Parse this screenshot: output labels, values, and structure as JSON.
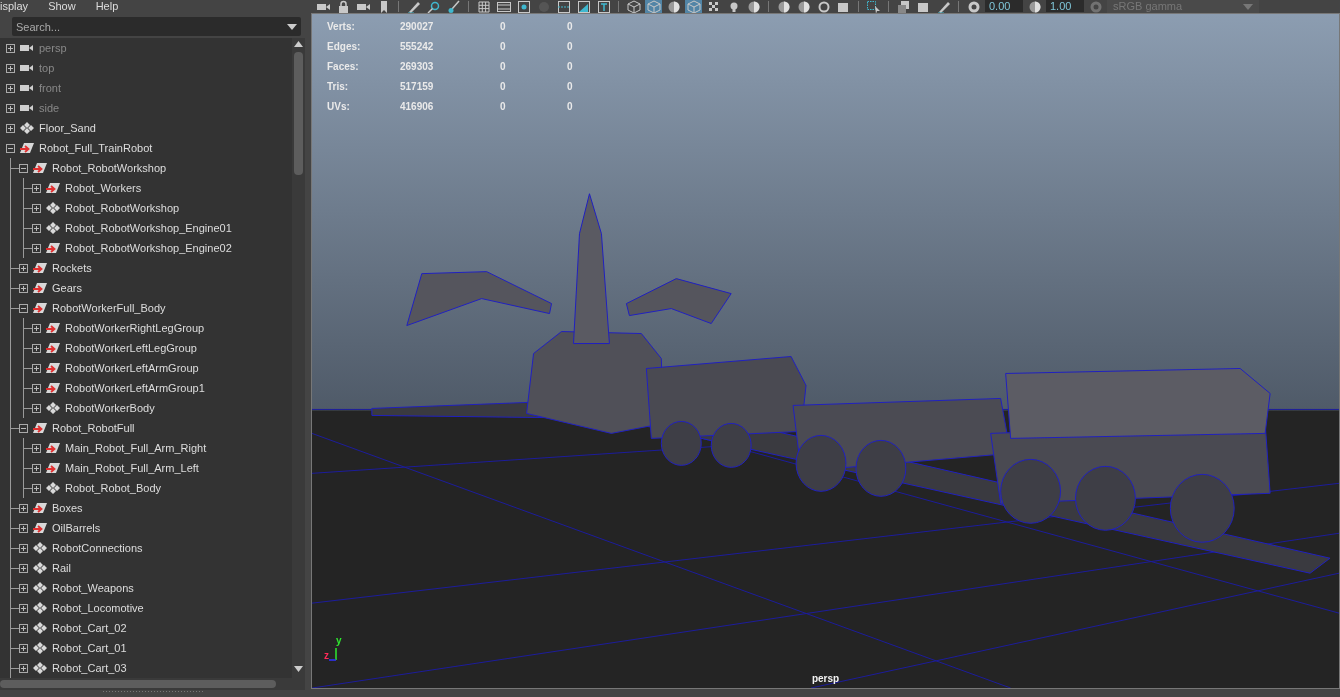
{
  "menu": [
    "isplay",
    "Show",
    "Help"
  ],
  "outliner": {
    "search": {
      "placeholder": "Search..."
    },
    "items": [
      {
        "label": "persp",
        "kind": "camera",
        "expanded": false
      },
      {
        "label": "top",
        "kind": "camera",
        "expanded": false
      },
      {
        "label": "front",
        "kind": "camera",
        "expanded": false
      },
      {
        "label": "side",
        "kind": "camera",
        "expanded": false
      },
      {
        "label": "Floor_Sand",
        "kind": "mesh",
        "expanded": false
      },
      {
        "label": "Robot_Full_TrainRobot",
        "kind": "group",
        "expanded": true,
        "children": [
          {
            "label": "Robot_RobotWorkshop",
            "kind": "group",
            "expanded": true,
            "children": [
              {
                "label": "Robot_Workers",
                "kind": "group",
                "expanded": false
              },
              {
                "label": "Robot_RobotWorkshop",
                "kind": "mesh",
                "expanded": false
              },
              {
                "label": "Robot_RobotWorkshop_Engine01",
                "kind": "mesh",
                "expanded": false
              },
              {
                "label": "Robot_RobotWorkshop_Engine02",
                "kind": "group",
                "expanded": false
              }
            ]
          },
          {
            "label": "Rockets",
            "kind": "group",
            "expanded": false
          },
          {
            "label": "Gears",
            "kind": "group",
            "expanded": false
          },
          {
            "label": "RobotWorkerFull_Body",
            "kind": "group",
            "expanded": true,
            "children": [
              {
                "label": "RobotWorkerRightLegGroup",
                "kind": "group",
                "expanded": false
              },
              {
                "label": "RobotWorkerLeftLegGroup",
                "kind": "group",
                "expanded": false
              },
              {
                "label": "RobotWorkerLeftArmGroup",
                "kind": "group",
                "expanded": false
              },
              {
                "label": "RobotWorkerLeftArmGroup1",
                "kind": "group",
                "expanded": false
              },
              {
                "label": "RobotWorkerBody",
                "kind": "mesh",
                "expanded": false
              }
            ]
          },
          {
            "label": "Robot_RobotFull",
            "kind": "group",
            "expanded": true,
            "children": [
              {
                "label": "Main_Robot_Full_Arm_Right",
                "kind": "group",
                "expanded": false
              },
              {
                "label": "Main_Robot_Full_Arm_Left",
                "kind": "group",
                "expanded": false
              },
              {
                "label": "Robot_Robot_Body",
                "kind": "mesh",
                "expanded": false
              }
            ]
          },
          {
            "label": "Boxes",
            "kind": "group",
            "expanded": false
          },
          {
            "label": "OilBarrels",
            "kind": "group",
            "expanded": false
          },
          {
            "label": "RobotConnections",
            "kind": "mesh",
            "expanded": false
          },
          {
            "label": "Rail",
            "kind": "mesh",
            "expanded": false
          },
          {
            "label": "Robot_Weapons",
            "kind": "mesh",
            "expanded": false
          },
          {
            "label": "Robot_Locomotive",
            "kind": "mesh",
            "expanded": false
          },
          {
            "label": "Robot_Cart_02",
            "kind": "mesh",
            "expanded": false
          },
          {
            "label": "Robot_Cart_01",
            "kind": "mesh",
            "expanded": false
          },
          {
            "label": "Robot_Cart_03",
            "kind": "mesh",
            "expanded": false
          }
        ]
      }
    ]
  },
  "viewport": {
    "toolbar": [
      {
        "kind": "camera",
        "selected": false
      },
      {
        "kind": "lock",
        "selected": false
      },
      {
        "kind": "camera",
        "selected": false
      },
      {
        "kind": "bookmark",
        "selected": false
      },
      {
        "kind": "separator"
      },
      {
        "kind": "pen",
        "selected": false
      },
      {
        "kind": "search",
        "selected": false
      },
      {
        "kind": "brush",
        "selected": false
      },
      {
        "kind": "separator"
      },
      {
        "kind": "grid",
        "selected": false
      },
      {
        "kind": "film",
        "selected": false
      },
      {
        "kind": "dot",
        "selected": false
      },
      {
        "kind": "circle",
        "selected": false
      },
      {
        "kind": "align",
        "selected": false
      },
      {
        "kind": "triangle",
        "selected": false
      },
      {
        "kind": "type",
        "selected": false
      },
      {
        "kind": "separator"
      },
      {
        "kind": "cube",
        "selected": false
      },
      {
        "kind": "cube",
        "selected": true
      },
      {
        "kind": "sphere",
        "selected": false
      },
      {
        "kind": "cube",
        "selected": true
      },
      {
        "kind": "checker",
        "selected": false
      },
      {
        "kind": "bulb",
        "selected": false
      },
      {
        "kind": "sphere",
        "selected": false
      },
      {
        "kind": "separator"
      },
      {
        "kind": "sphere",
        "selected": false
      },
      {
        "kind": "sphere",
        "selected": false
      },
      {
        "kind": "ring",
        "selected": false
      },
      {
        "kind": "square",
        "selected": false
      },
      {
        "kind": "separator"
      },
      {
        "kind": "select",
        "selected": false
      },
      {
        "kind": "separator"
      },
      {
        "kind": "copy",
        "selected": false
      },
      {
        "kind": "square",
        "selected": false
      },
      {
        "kind": "pen",
        "selected": false
      },
      {
        "kind": "separator"
      },
      {
        "kind": "aperture",
        "selected": false
      },
      {
        "kind": "field",
        "value": "0.00"
      },
      {
        "kind": "sphere",
        "selected": false
      },
      {
        "kind": "field",
        "value": "1.00"
      },
      {
        "kind": "aperture",
        "selected": false,
        "disabled": true
      },
      {
        "kind": "dropdown",
        "value": "sRGB gamma",
        "disabled": true
      }
    ],
    "stats": [
      {
        "label": "Verts:",
        "values": [
          "290027",
          "0",
          "0"
        ]
      },
      {
        "label": "Edges:",
        "values": [
          "555242",
          "0",
          "0"
        ]
      },
      {
        "label": "Faces:",
        "values": [
          "269303",
          "0",
          "0"
        ]
      },
      {
        "label": "Tris:",
        "values": [
          "517159",
          "0",
          "0"
        ]
      },
      {
        "label": "UVs:",
        "values": [
          "416906",
          "0",
          "0"
        ]
      }
    ],
    "axis_labels": [
      "y",
      "z"
    ],
    "camera": "persp"
  }
}
